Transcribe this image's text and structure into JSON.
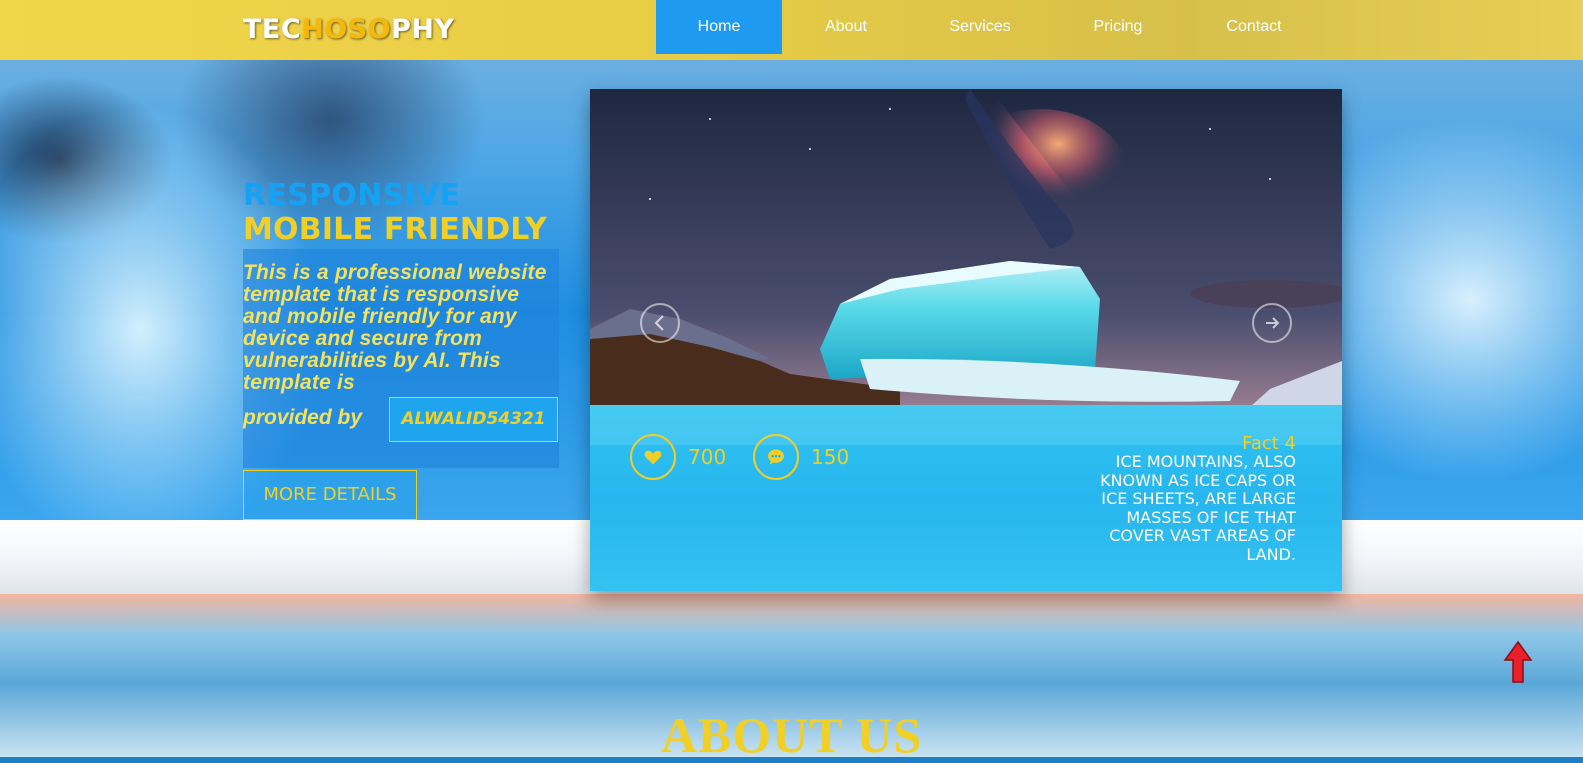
{
  "brand": {
    "logo_part1": "TEC",
    "logo_part2": "HOSO",
    "logo_part3": "PHY",
    "accent_blue": "#1e9bf0",
    "accent_yellow": "#f2cf25",
    "navbar_color": "#e9cd45"
  },
  "nav": {
    "items": [
      {
        "label": "Home",
        "active": true
      },
      {
        "label": "About",
        "active": false
      },
      {
        "label": "Services",
        "active": false
      },
      {
        "label": "Pricing",
        "active": false
      },
      {
        "label": "Contact",
        "active": false
      }
    ]
  },
  "hero": {
    "line1": "RESPONSIVE",
    "line2": "MOBILE FRIENDLY",
    "description": "This is a professional website template that is responsive and mobile friendly for any device and secure from vulnerabilities by AI. This template is",
    "provided_by": "provided by",
    "author_button": "ALWALID54321",
    "more_button": "MORE DETAILS"
  },
  "slider": {
    "prev_icon": "arrow-left-icon",
    "next_icon": "arrow-right-icon",
    "likes_icon": "heart-icon",
    "likes": "700",
    "comments_icon": "comment-icon",
    "comments": "150",
    "fact_title": "Fact 4",
    "fact_text": "ICE MOUNTAINS, ALSO KNOWN AS ICE CAPS OR ICE SHEETS, ARE LARGE MASSES OF ICE THAT COVER VAST AREAS OF LAND."
  },
  "about": {
    "title": "ABOUT US"
  },
  "scroll_top_icon": "arrow-up-icon"
}
